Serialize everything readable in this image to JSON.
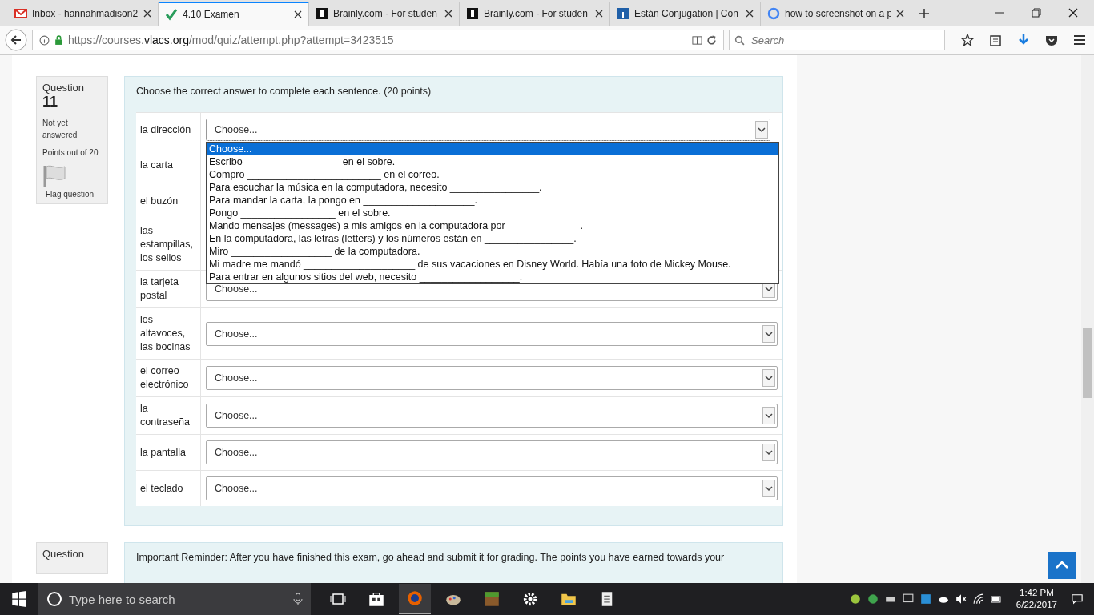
{
  "tabs": [
    {
      "kind": "mail",
      "label": "Inbox - hannahmadison2",
      "selected": false
    },
    {
      "kind": "check",
      "label": "4.10 Examen",
      "selected": true
    },
    {
      "kind": "letter",
      "label": "Brainly.com - For studen",
      "selected": false
    },
    {
      "kind": "letter",
      "label": "Brainly.com - For studen",
      "selected": false
    },
    {
      "kind": "info",
      "label": "Están Conjugation | Con",
      "selected": false
    },
    {
      "kind": "google",
      "label": "how to screenshot on a p",
      "selected": false
    }
  ],
  "address": {
    "prefix": "https://courses.",
    "domain": "vlacs.org",
    "path": "/mod/quiz/attempt.php?attempt=3423515"
  },
  "search": {
    "placeholder": "Search"
  },
  "question": {
    "label": "Question",
    "number": "11",
    "status": "Not yet answered",
    "points": "Points out of 20",
    "flag": "Flag question",
    "prompt": "Choose the correct answer to complete each sentence. (20 points)",
    "rows": [
      {
        "term": "la dirección",
        "select": {
          "value": "Choose...",
          "expanded": true,
          "options": [
            {
              "text": "Choose...",
              "selected": true
            },
            {
              "text": "Escribo _________________ en el sobre.",
              "selected": false
            },
            {
              "text": "Compro ________________________ en el correo.",
              "selected": false
            },
            {
              "text": "Para escuchar la música en la computadora, necesito ________________.",
              "selected": false
            },
            {
              "text": "Para mandar la carta, la pongo en ____________________.",
              "selected": false
            },
            {
              "text": "Pongo _________________ en el sobre.",
              "selected": false
            },
            {
              "text": "Mando mensajes (messages) a mis amigos en la computadora por _____________.",
              "selected": false
            },
            {
              "text": "En la computadora, las letras (letters) y los números están en ________________.",
              "selected": false
            },
            {
              "text": "Miro __________________ de la computadora.",
              "selected": false
            },
            {
              "text": "Mi madre me mandó ____________________ de sus vacaciones en Disney World. Había una foto de Mickey Mouse.",
              "selected": false
            },
            {
              "text": "Para entrar en algunos sitios del web, necesito __________________.",
              "selected": false
            }
          ]
        }
      },
      {
        "term": "la carta"
      },
      {
        "term": "el buzón"
      },
      {
        "term": "las estampillas, los sellos"
      },
      {
        "term": "la tarjeta postal",
        "select": {
          "value": "Choose...",
          "expanded": false
        }
      },
      {
        "term": "los altavoces, las bocinas",
        "select": {
          "value": "Choose...",
          "expanded": false
        }
      },
      {
        "term": "el correo electrónico",
        "select": {
          "value": "Choose...",
          "expanded": false
        }
      },
      {
        "term": "la contraseña",
        "select": {
          "value": "Choose...",
          "expanded": false
        }
      },
      {
        "term": "la pantalla",
        "select": {
          "value": "Choose...",
          "expanded": false
        }
      },
      {
        "term": "el teclado",
        "select": {
          "value": "Choose...",
          "expanded": false
        }
      }
    ]
  },
  "next_question": {
    "label": "Question",
    "text": "Important Reminder: After you have finished this exam, go ahead and submit it for grading. The points you have earned towards your"
  },
  "taskbar": {
    "search_placeholder": "Type here to search",
    "time": "1:42 PM",
    "date": "6/22/2017"
  }
}
